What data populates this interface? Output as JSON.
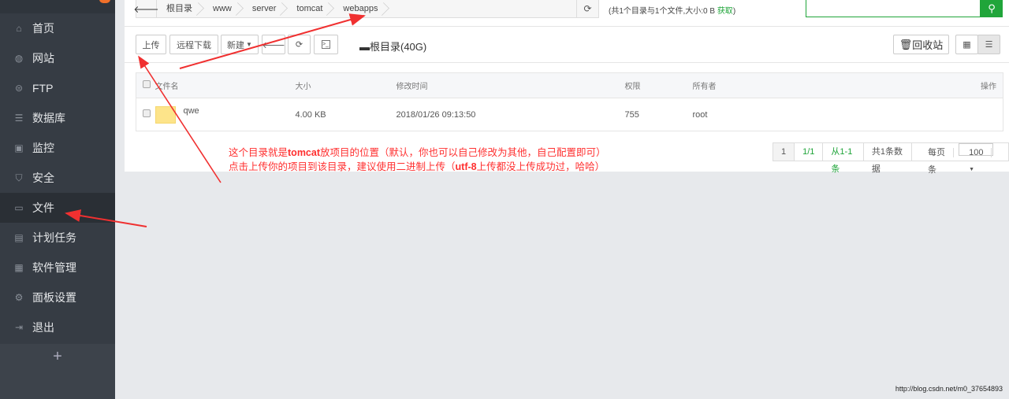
{
  "sidebar": {
    "items": [
      {
        "label": "首页",
        "icon": "home-icon"
      },
      {
        "label": "网站",
        "icon": "globe-icon"
      },
      {
        "label": "FTP",
        "icon": "ftp-icon"
      },
      {
        "label": "数据库",
        "icon": "database-icon"
      },
      {
        "label": "监控",
        "icon": "monitor-icon"
      },
      {
        "label": "安全",
        "icon": "shield-icon"
      },
      {
        "label": "文件",
        "icon": "folder-icon",
        "active": true
      },
      {
        "label": "计划任务",
        "icon": "calendar-icon"
      },
      {
        "label": "软件管理",
        "icon": "grid-icon"
      },
      {
        "label": "面板设置",
        "icon": "gear-icon"
      },
      {
        "label": "退出",
        "icon": "logout-icon"
      }
    ],
    "add_label": "+"
  },
  "breadcrumb": [
    "根目录",
    "www",
    "server",
    "tomcat",
    "webapps"
  ],
  "summary": {
    "text": "(共1个目录与1个文件,大小:0 B ",
    "link": "获取",
    "end": ")"
  },
  "search": {
    "placeholder": "",
    "value": ""
  },
  "toolbar": {
    "upload": "上传",
    "remote_download": "远程下载",
    "new": "新建",
    "disk": "根目录(40G)",
    "recycle": "回收站"
  },
  "table": {
    "headers": [
      "文件名",
      "大小",
      "修改时间",
      "权限",
      "所有者",
      "操作"
    ],
    "rows": [
      {
        "name": "qwe",
        "size": "4.00 KB",
        "mtime": "2018/01/26 09:13:50",
        "perm": "755",
        "owner": "root"
      }
    ]
  },
  "pager": {
    "current": "1",
    "pages": "1/1",
    "range": "从1-1条",
    "total": "共1条数据",
    "per_page_label": "每页",
    "per_page": "100",
    "unit": "条"
  },
  "annotation": {
    "l1a": "这个目录就是",
    "l1b": "tomcat",
    "l1c": "放项目的位置（默认，你也可以自己修改为其他，自己配置即可）",
    "l2a": "点击上传你的项目到该目录，建议使用二进制上传（",
    "l2b": "utf-8",
    "l2c": "上传都没上传成功过，哈哈）"
  },
  "watermark": "http://blog.csdn.net/m0_37654893",
  "colors": {
    "accent": "#20a53a",
    "annotation": "#ff3030",
    "sidebar": "#363c44"
  }
}
